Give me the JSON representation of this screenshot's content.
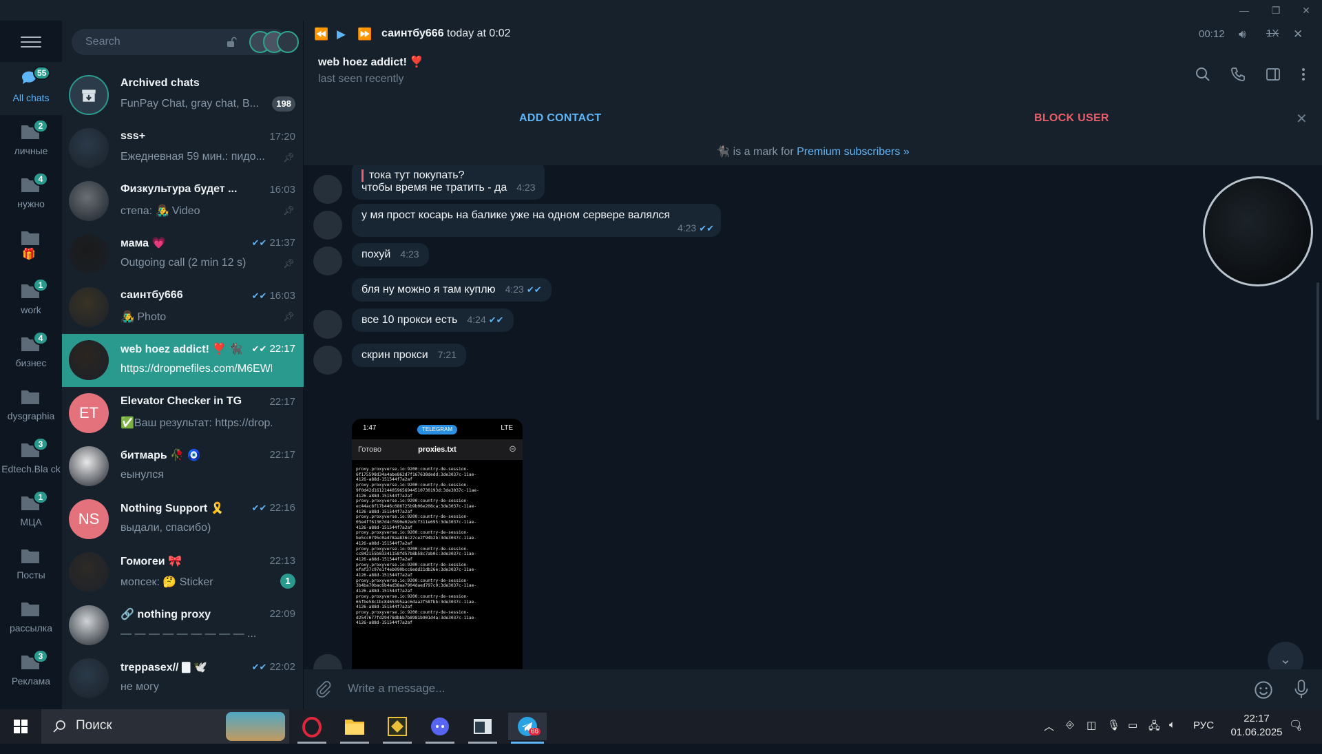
{
  "colors": {
    "accent": "#5eb5f7",
    "active_chat": "#2b9a8e",
    "danger": "#ec5d69",
    "bubble": "#182533",
    "sidebar": "#17212b"
  },
  "search": {
    "placeholder": "Search"
  },
  "folders": [
    {
      "label": "All chats",
      "badge": "55",
      "icon": "chats-icon"
    },
    {
      "label": "личные",
      "badge": "2",
      "icon": "folder-icon"
    },
    {
      "label": "нужно",
      "badge": "4",
      "icon": "folder-icon"
    },
    {
      "label": "",
      "badge": "",
      "icon": "folder-gift-icon"
    },
    {
      "label": "work",
      "badge": "1",
      "icon": "folder-icon"
    },
    {
      "label": "бизнес",
      "badge": "4",
      "icon": "folder-icon"
    },
    {
      "label": "dysgraphia",
      "badge": "",
      "icon": "folder-icon"
    },
    {
      "label": "Edtech.Bla ck",
      "badge": "3",
      "icon": "folder-icon"
    },
    {
      "label": "МЦА",
      "badge": "1",
      "icon": "folder-icon"
    },
    {
      "label": "Посты",
      "badge": "",
      "icon": "folder-icon"
    },
    {
      "label": "рассылка",
      "badge": "",
      "icon": "folder-icon"
    },
    {
      "label": "Реклама",
      "badge": "3",
      "icon": "folder-icon"
    }
  ],
  "chats": [
    {
      "name": "Archived chats",
      "preview": "FunPay Chat, gray chat, B...",
      "time": "",
      "badge": "198",
      "avatar": "archive-icon"
    },
    {
      "name": "sss+",
      "preview": "Ежедневная 59 мин.: пидо...",
      "time": "17:20",
      "pinned": true
    },
    {
      "name": "Физкультура будет ...",
      "preview": "степа: 👨‍🎤 Video",
      "time": "16:03",
      "pinned": true
    },
    {
      "name": "мама 💗",
      "preview": "Outgoing call (2 min 12 s)",
      "time": "21:37",
      "read": true,
      "pinned": true
    },
    {
      "name": "саинтбу666",
      "preview": "👨‍🎤 Photo",
      "time": "16:03",
      "read": true,
      "pinned": true
    },
    {
      "name": "web hoez addict! ❣️ 🐈‍⬛",
      "preview": "https://dropmefiles.com/M6EWD",
      "time": "22:17",
      "read": true,
      "active": true
    },
    {
      "name": "Elevator Checker in TG",
      "preview": "✅Ваш результат: https://drop...",
      "time": "22:17",
      "initials": "ET",
      "avatar_color": "#e4727c"
    },
    {
      "name": "битмарь 🥀 🧿",
      "preview": "еынулся",
      "time": "22:17"
    },
    {
      "name": "Nothing Support 🎗️",
      "preview": "выдали, спасибо)",
      "time": "22:16",
      "read": true,
      "initials": "NS",
      "avatar_color": "#e4727c"
    },
    {
      "name": "Гомогеи 🎀",
      "preview": "мопсек: 🤔 Sticker",
      "time": "22:13",
      "badge": "1"
    },
    {
      "name": "🔗 nothing proxy",
      "preview": "— — — — — — — — — ...",
      "time": "22:09"
    },
    {
      "name": "treppasex// 🀫 🕊️",
      "preview": "не могу",
      "time": "22:02",
      "read": true
    }
  ],
  "player": {
    "author": "саинтбу666",
    "when": "today at 0:02",
    "elapsed": "00:12",
    "speed": "1X"
  },
  "peer": {
    "name": "web hoez addict! ❣️",
    "status": "last seen recently"
  },
  "actions": {
    "add_contact": "ADD CONTACT",
    "block_user": "BLOCK USER"
  },
  "premium": {
    "text": "is a mark for",
    "link": "Premium subscribers »"
  },
  "messages": [
    {
      "text": "тока тут покупать?\nчтобы время не тратить - да",
      "time": "4:23",
      "out": false
    },
    {
      "text": "у мя прост косарь на балике уже на одном сервере валялся",
      "time": "4:23",
      "read": true
    },
    {
      "text": "похуй",
      "time": "4:23"
    },
    {
      "text": "бля ну можно я там куплю",
      "time": "4:23",
      "read": true
    },
    {
      "text": "все 10 прокси есть",
      "time": "4:24",
      "read": true
    },
    {
      "text": "скрин прокси",
      "time": "7:21"
    }
  ],
  "screenshot": {
    "status_time": "1:47",
    "pill": "TELEGRAM",
    "network": "LTE",
    "done": "Готово",
    "file": "proxies.txt",
    "lines": [
      "proxy.proxyverse.io:9200:country-de-session-",
      "6f175598d34a4abe862d7f167638dedd:3de3037c-11ae-",
      "4126-a88d-151544f7a2af",
      "proxy.proxyverse.io:9200:country-de-session-",
      "9f0d42d1612144059656944510730193d:3de3037c-11ae-",
      "4126-a88d-151544f7a2af",
      "proxy.proxyverse.io:9200:country-de-session-",
      "ec44ac8f17b446c686725b9b06e208ca:3de3037c-11ae-",
      "4126-a88d-151544f7a2af",
      "proxy.proxyverse.io:9200:country-de-session-",
      "05e4ff61367d4cf690e02edcf311e695:3de3037c-11ae-",
      "4126-a88d-151544f7a2af",
      "proxy.proxyverse.io:9200:country-de-session-",
      "be5cc0795c0a478aa836c27ce2f94b2b:3de3037c-11ae-",
      "4126-a88d-151544f7a2af",
      "proxy.proxyverse.io:9200:country-de-session-",
      "cc842155b03341158fd57b8b58c7ab0c:3de3037c-11ae-",
      "4126-a88d-151544f7a2af",
      "proxy.proxyverse.io:9200:country-de-session-",
      "efaf37c97e1f4eb090bcc8edd21db26e:3de3037c-11ae-",
      "4126-a88d-151544f7a2af",
      "proxy.proxyverse.io:9200:country-de-session-",
      "3b4ba70bac6b4ad38aa7904daed797c0:3de3037c-11ae-",
      "4126-a88d-151544f7a2af",
      "proxy.proxyverse.io:9200:country-de-session-",
      "65fbe58c1bc8465395aac6daa2f58fbb:3de3037c-11ae-",
      "4126-a88d-151544f7a2af",
      "proxy.proxyverse.io:9200:country-de-session-",
      "d2547677fd29478dbbb7b8981b901d4a:3de3037c-11ae-",
      "4126-a88d-151544f7a2af"
    ]
  },
  "composer": {
    "placeholder": "Write a message..."
  },
  "taskbar": {
    "search": "Поиск",
    "lang": "РУС",
    "time": "22:17",
    "date": "01.06.2025",
    "notif_count": "6",
    "tg_badge": "66"
  }
}
